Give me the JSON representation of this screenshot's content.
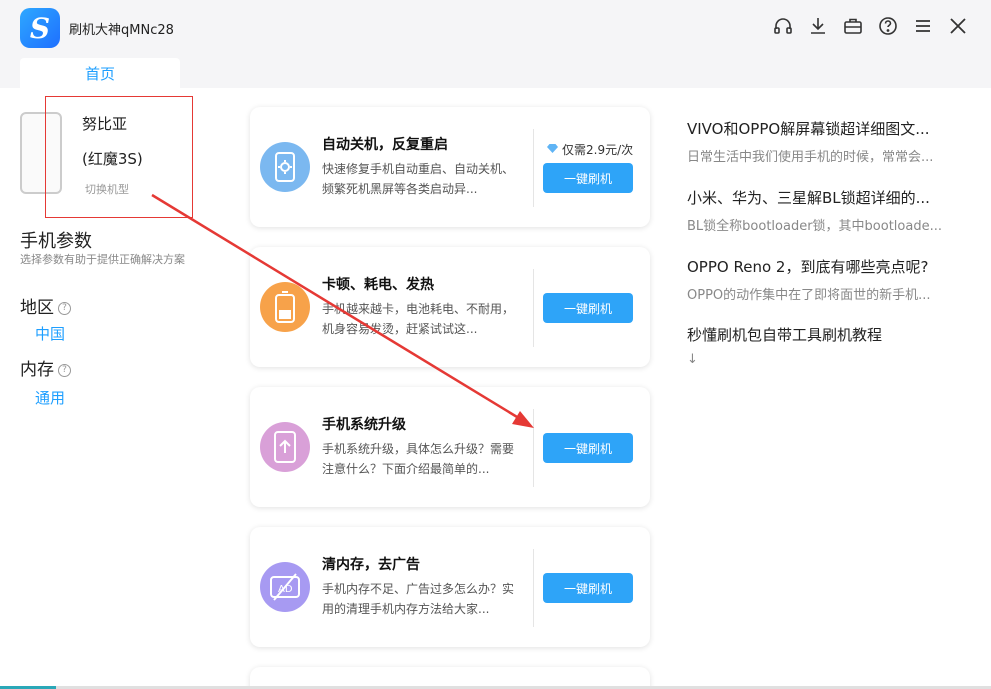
{
  "app": {
    "title": "刷机大神qMNc28",
    "logo_glyph": "S",
    "brand_color": "#1e9fff"
  },
  "window_icons": [
    "headset-icon",
    "download-icon",
    "toolbox-icon",
    "help-icon",
    "menu-icon",
    "close-icon"
  ],
  "tabs": [
    {
      "label": "首页",
      "active": true
    }
  ],
  "device": {
    "model": "努比亚",
    "variant": "(红魔3S)",
    "switch_label": "切换机型"
  },
  "params": {
    "title": "手机参数",
    "subtitle": "选择参数有助于提供正确解决方案",
    "region_label": "地区",
    "region_value": "中国",
    "memory_label": "内存",
    "memory_value": "通用",
    "help_glyph": "?"
  },
  "cards": [
    {
      "title": "自动关机，反复重启",
      "desc": "快速修复手机自动重启、自动关机、频繁死机黑屏等各类启动异...",
      "price": "仅需2.9元/次",
      "button": "一键刷机",
      "icon": "power-cycle-icon",
      "icon_color": "#7bb8f0"
    },
    {
      "title": "卡顿、耗电、发热",
      "desc": "手机越来越卡，电池耗电、不耐用，机身容易发烫，赶紧试试这...",
      "button": "一键刷机",
      "icon": "battery-icon",
      "icon_color": "#f7a24a"
    },
    {
      "title": "手机系统升级",
      "desc": "手机系统升级，具体怎么升级？需要注意什么？下面介绍最简单的...",
      "button": "一键刷机",
      "icon": "system-upgrade-icon",
      "icon_color": "#d9a0d8"
    },
    {
      "title": "清内存，去广告",
      "desc": "手机内存不足、广告过多怎么办？实用的清理手机内存方法给大家...",
      "button": "一键刷机",
      "icon": "ad-block-icon",
      "icon_color": "#a79af2",
      "icon_text": "AD"
    }
  ],
  "articles": [
    {
      "title": "VIVO和OPPO解屏幕锁超详细图文...",
      "desc": "日常生活中我们使用手机的时候，常常会..."
    },
    {
      "title": "小米、华为、三星解BL锁超详细的...",
      "desc": "BL锁全称bootloader锁，其中bootloade..."
    },
    {
      "title": "OPPO Reno 2，到底有哪些亮点呢?",
      "desc": "OPPO的动作集中在了即将面世的新手机..."
    },
    {
      "title": "秒懂刷机包自带工具刷机教程",
      "desc": "↓"
    }
  ],
  "annotation_color": "#e53935"
}
